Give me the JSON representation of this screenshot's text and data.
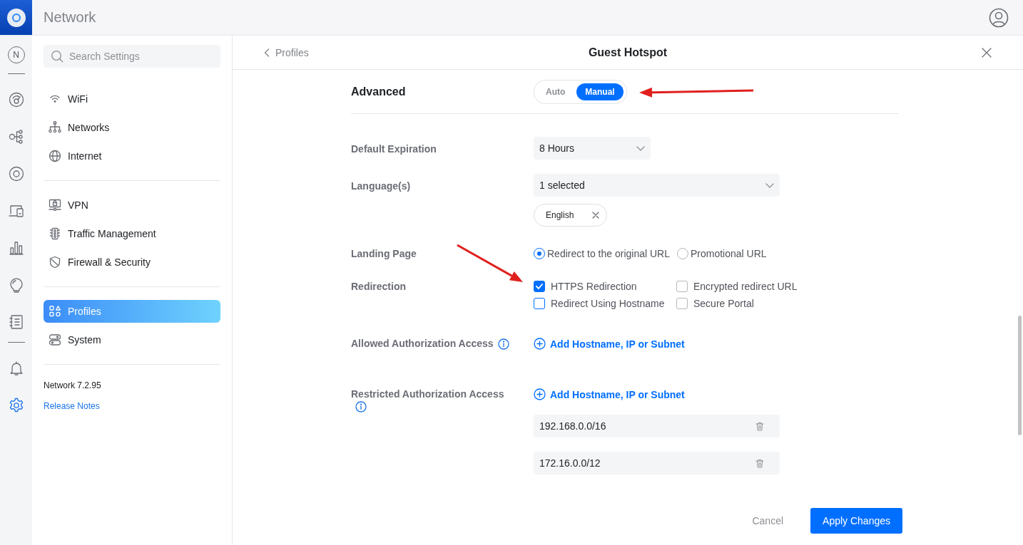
{
  "app": {
    "title": "Network"
  },
  "rail": [
    {
      "kind": "letter",
      "label": "N",
      "selected": false
    },
    {
      "kind": "divider"
    },
    {
      "kind": "dial",
      "selected": false
    },
    {
      "kind": "topology",
      "selected": false
    },
    {
      "kind": "target",
      "selected": false
    },
    {
      "kind": "devices",
      "selected": false
    },
    {
      "kind": "stats",
      "selected": false
    },
    {
      "kind": "bulb",
      "selected": false
    },
    {
      "kind": "log",
      "selected": false
    },
    {
      "kind": "divider"
    },
    {
      "kind": "bell",
      "selected": false
    },
    {
      "kind": "gear",
      "selected": true
    }
  ],
  "sidebar": {
    "search": {
      "placeholder": "Search Settings"
    },
    "groups": [
      [
        {
          "label": "WiFi",
          "kind": "wifi",
          "selected": false
        },
        {
          "label": "Networks",
          "kind": "networks",
          "selected": false
        },
        {
          "label": "Internet",
          "kind": "globe",
          "selected": false
        }
      ],
      [
        {
          "label": "VPN",
          "kind": "vpn",
          "selected": false
        },
        {
          "label": "Traffic Management",
          "kind": "traffic",
          "selected": false
        },
        {
          "label": "Firewall & Security",
          "kind": "shield",
          "selected": false
        }
      ],
      [
        {
          "label": "Profiles",
          "kind": "profiles",
          "selected": true
        },
        {
          "label": "System",
          "kind": "system",
          "selected": false
        }
      ]
    ],
    "version": "Network 7.2.95",
    "release_notes": "Release Notes"
  },
  "header": {
    "back": "Profiles",
    "title": "Guest Hotspot"
  },
  "advanced": {
    "label": "Advanced",
    "segments": [
      {
        "label": "Auto",
        "selected": false
      },
      {
        "label": "Manual",
        "selected": true
      }
    ]
  },
  "fields": [
    {
      "kind": "select",
      "label": "Default Expiration",
      "value": "8 Hours"
    },
    {
      "kind": "multiselect",
      "label": "Language(s)",
      "value": "1 selected",
      "chips": [
        "English"
      ]
    },
    {
      "kind": "radio",
      "label": "Landing Page",
      "options": [
        {
          "label": "Redirect to the original URL",
          "selected": true
        },
        {
          "label": "Promotional URL",
          "selected": false
        }
      ]
    },
    {
      "kind": "checkbox",
      "label": "Redirection",
      "options": [
        {
          "label": "HTTPS Redirection",
          "checked": true
        },
        {
          "label": "Encrypted redirect URL",
          "checked": false
        },
        {
          "label": "Redirect Using Hostname",
          "checked": false
        },
        {
          "label": "Secure Portal",
          "checked": false
        }
      ]
    },
    {
      "kind": "hostlist",
      "label": "Allowed Authorization Access",
      "info": true,
      "add": "Add Hostname, IP or Subnet"
    },
    {
      "kind": "hostlist",
      "label": "Restricted Authorization Access",
      "info": true,
      "add": "Add Hostname, IP or Subnet",
      "entries": [
        "192.168.0.0/16",
        "172.16.0.0/12"
      ]
    }
  ],
  "footer": {
    "cancel": "Cancel",
    "apply": "Apply Changes"
  },
  "annotations": [
    {
      "kind": "arrow"
    },
    {
      "kind": "arrow"
    }
  ]
}
